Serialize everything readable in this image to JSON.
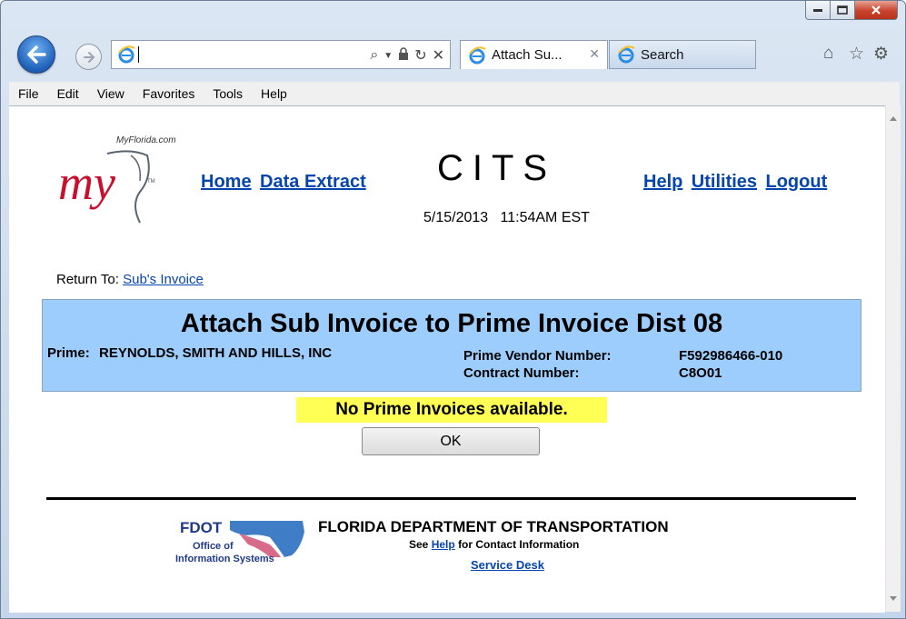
{
  "browser": {
    "address_value": "",
    "tabs": [
      {
        "label": "Attach Su...",
        "active": true
      },
      {
        "label": "Search",
        "active": false
      }
    ],
    "menu": [
      "File",
      "Edit",
      "View",
      "Favorites",
      "Tools",
      "Help"
    ]
  },
  "page": {
    "logo_text": "MyFlorida.com",
    "app_title": "CITS",
    "datetime": "5/15/2013   11:54AM EST",
    "nav_left": [
      "Home",
      "Data Extract"
    ],
    "nav_right": [
      "Help",
      "Utilities",
      "Logout"
    ],
    "return_label": "Return To:",
    "return_link": "Sub's Invoice",
    "banner": {
      "title": "Attach Sub Invoice to Prime Invoice Dist 08",
      "prime_label": "Prime:",
      "prime_value": "REYNOLDS, SMITH AND HILLS, INC",
      "vendor_label": "Prime Vendor Number:",
      "vendor_value": "F592986466-010",
      "contract_label": "Contract Number:",
      "contract_value": "C8O01"
    },
    "message": "No Prime Invoices available.",
    "ok_label": "OK",
    "footer": {
      "fdot_title": "FDOT",
      "fdot_sub1": "Office of",
      "fdot_sub2": "Information Systems",
      "dept": "FLORIDA DEPARTMENT OF TRANSPORTATION",
      "see_pre": "See",
      "see_link": "Help",
      "see_post": "for Contact Information",
      "service_desk": "Service Desk"
    }
  },
  "colors": {
    "banner": "#9ccdfc",
    "message_bg": "#ffff55",
    "link": "#0645ad"
  }
}
